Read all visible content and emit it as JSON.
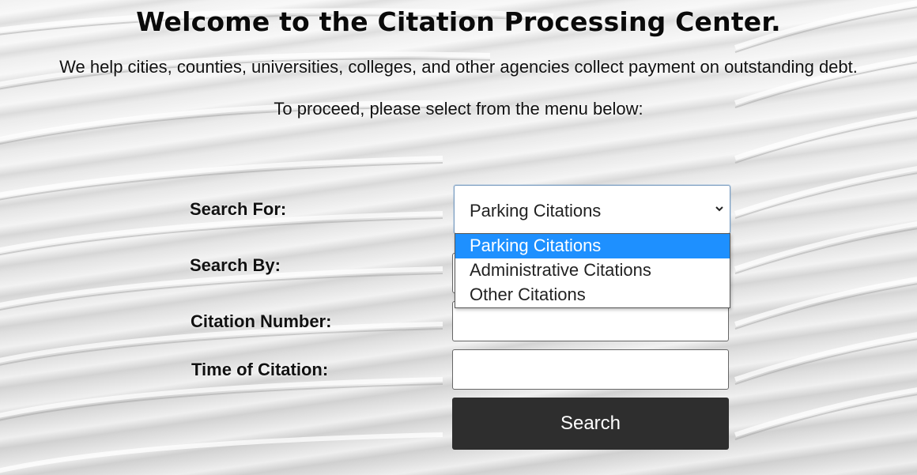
{
  "header": {
    "title": "Welcome to the Citation Processing Center.",
    "subtitle": "We help cities, counties, universities, colleges, and other agencies collect payment on outstanding debt.",
    "instruction": "To proceed, please select from the menu below:"
  },
  "form": {
    "search_for_label": "Search For:",
    "search_for_value": "Parking Citations",
    "search_for_options": [
      "Parking Citations",
      "Administrative Citations",
      "Other Citations"
    ],
    "search_by_label": "Search By:",
    "citation_number_label": "Citation Number:",
    "citation_number_value": "",
    "time_of_citation_label": "Time of Citation:",
    "time_of_citation_value": "",
    "search_button": "Search"
  },
  "icons": {
    "select_chevron": "chevron-down-icon"
  },
  "colors": {
    "selected_option_bg": "#1e90ff",
    "button_bg": "#2e2e2e"
  }
}
